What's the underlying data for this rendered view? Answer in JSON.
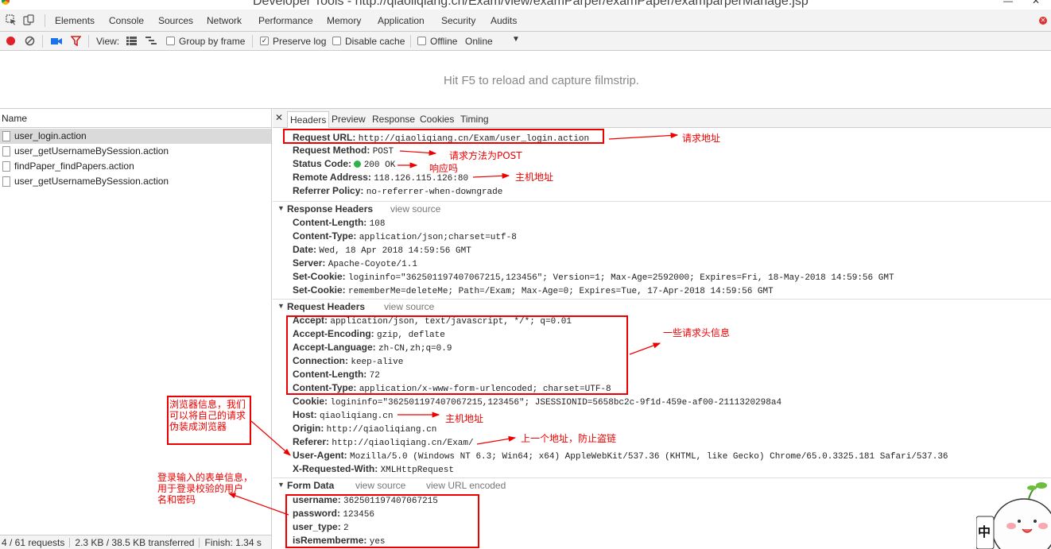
{
  "window": {
    "title": "Developer Tools - http://qiaoliqiang.cn/Exam/view/examParper/examPaper/examparperManage.jsp"
  },
  "tabs": [
    "Elements",
    "Console",
    "Sources",
    "Network",
    "Performance",
    "Memory",
    "Application",
    "Security",
    "Audits"
  ],
  "toolbar": {
    "view_label": "View:",
    "group_by_frame": "Group by frame",
    "preserve_log": "Preserve log",
    "disable_cache": "Disable cache",
    "offline": "Offline",
    "throttle": "Online",
    "preserve_log_checked": true
  },
  "filmstrip": {
    "hint": "Hit F5 to reload and capture filmstrip."
  },
  "requests": {
    "column_header": "Name",
    "items": [
      "user_login.action",
      "user_getUsernameBySession.action",
      "findPaper_findPapers.action",
      "user_getUsernameBySession.action"
    ],
    "selected_index": 0
  },
  "status_bar": {
    "requests": "4 / 61 requests",
    "transferred": "2.3 KB / 38.5 KB transferred",
    "finish": "Finish: 1.34 s"
  },
  "detail_tabs": [
    "Headers",
    "Preview",
    "Response",
    "Cookies",
    "Timing"
  ],
  "general": {
    "request_url": {
      "key": "Request URL:",
      "value": "http://qiaoliqiang.cn/Exam/user_login.action"
    },
    "request_method": {
      "key": "Request Method:",
      "value": "POST"
    },
    "status_code": {
      "key": "Status Code:",
      "value": "200 OK"
    },
    "remote_address": {
      "key": "Remote Address:",
      "value": "118.126.115.126:80"
    },
    "referrer_policy": {
      "key": "Referrer Policy:",
      "value": "no-referrer-when-downgrade"
    }
  },
  "response_headers": {
    "title": "Response Headers",
    "view_source": "view source",
    "items": [
      {
        "key": "Content-Length:",
        "value": "108"
      },
      {
        "key": "Content-Type:",
        "value": "application/json;charset=utf-8"
      },
      {
        "key": "Date:",
        "value": "Wed, 18 Apr 2018 14:59:56 GMT"
      },
      {
        "key": "Server:",
        "value": "Apache-Coyote/1.1"
      },
      {
        "key": "Set-Cookie:",
        "value": "logininfo=\"362501197407067215,123456\"; Version=1; Max-Age=2592000; Expires=Fri, 18-May-2018 14:59:56 GMT"
      },
      {
        "key": "Set-Cookie:",
        "value": "rememberMe=deleteMe; Path=/Exam; Max-Age=0; Expires=Tue, 17-Apr-2018 14:59:56 GMT"
      }
    ]
  },
  "request_headers": {
    "title": "Request Headers",
    "view_source": "view source",
    "items": [
      {
        "key": "Accept:",
        "value": "application/json, text/javascript, */*; q=0.01"
      },
      {
        "key": "Accept-Encoding:",
        "value": "gzip, deflate"
      },
      {
        "key": "Accept-Language:",
        "value": "zh-CN,zh;q=0.9"
      },
      {
        "key": "Connection:",
        "value": "keep-alive"
      },
      {
        "key": "Content-Length:",
        "value": "72"
      },
      {
        "key": "Content-Type:",
        "value": "application/x-www-form-urlencoded; charset=UTF-8"
      },
      {
        "key": "Cookie:",
        "value": "logininfo=\"362501197407067215,123456\"; JSESSIONID=5658bc2c-9f1d-459e-af00-2111320298a4"
      },
      {
        "key": "Host:",
        "value": "qiaoliqiang.cn"
      },
      {
        "key": "Origin:",
        "value": "http://qiaoliqiang.cn"
      },
      {
        "key": "Referer:",
        "value": "http://qiaoliqiang.cn/Exam/"
      },
      {
        "key": "User-Agent:",
        "value": "Mozilla/5.0 (Windows NT 6.3; Win64; x64) AppleWebKit/537.36 (KHTML, like Gecko) Chrome/65.0.3325.181 Safari/537.36"
      },
      {
        "key": "X-Requested-With:",
        "value": "XMLHttpRequest"
      }
    ]
  },
  "form_data": {
    "title": "Form Data",
    "view_source": "view source",
    "view_url_encoded": "view URL encoded",
    "items": [
      {
        "key": "username:",
        "value": "362501197407067215"
      },
      {
        "key": "password:",
        "value": "123456"
      },
      {
        "key": "user_type:",
        "value": "2"
      },
      {
        "key": "isRememberme:",
        "value": "yes"
      }
    ]
  },
  "annotations": {
    "request_url": "请求地址",
    "method": "请求方法为POST",
    "status": "响应吗",
    "remote": "主机地址",
    "req_headers": "一些请求头信息",
    "browser_line1": "浏览器信息，我们",
    "browser_line2": "可以将自己的请求",
    "browser_line3": "伪装成浏览器",
    "host": "主机地址",
    "referer": "上一个地址，防止盗链",
    "form_line1": "登录输入的表单信息，",
    "form_line2": "用于登录校验的用户",
    "form_line3": "名和密码"
  },
  "mascot": {
    "label": "中"
  },
  "colors": {
    "annotation": "#ee0000",
    "status_ok": "#2db34a",
    "record": "#e0202a",
    "filter": "#d92020",
    "camera": "#1a73e8"
  }
}
